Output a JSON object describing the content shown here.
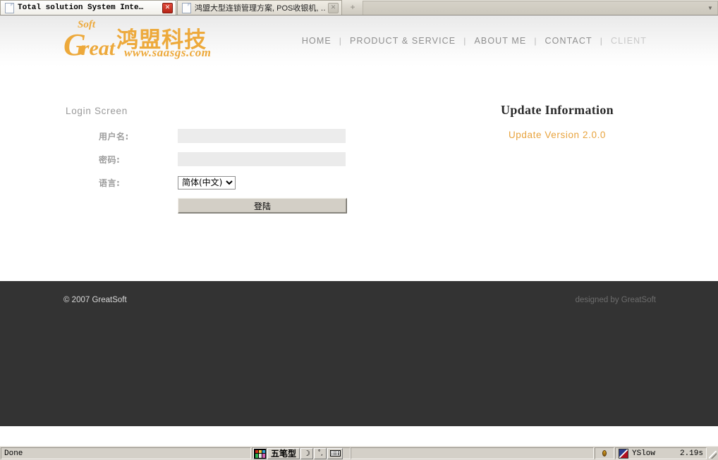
{
  "browser": {
    "tabs": [
      {
        "title": "Total solution System Inte…",
        "active": true,
        "close_icon": "close-icon",
        "page_icon": "page-icon"
      },
      {
        "title": "鸿盟大型连锁管理方案, POS收银机, …",
        "active": false,
        "close_icon": "close-icon",
        "page_icon": "page-icon"
      }
    ],
    "new_tab_label": "+",
    "tab_list_icon": "chevron-down-icon"
  },
  "site": {
    "logo": {
      "soft": "Soft",
      "g": "G",
      "reat": "reat",
      "chinese": "鸿盟科技",
      "url": "www.saasgs.com",
      "color": "#eda93b"
    },
    "nav": {
      "items": [
        {
          "label": "HOME",
          "dim": false
        },
        {
          "label": "PRODUCT & SERVICE",
          "dim": false
        },
        {
          "label": "ABOUT ME",
          "dim": false
        },
        {
          "label": "CONTACT",
          "dim": false
        },
        {
          "label": "CLIENT",
          "dim": true
        }
      ],
      "separator": "|"
    }
  },
  "login": {
    "screen_title": "Login Screen",
    "fields": {
      "username_label": "用户名:",
      "username_value": "",
      "username_placeholder": "",
      "password_label": "密码:",
      "password_value": "",
      "password_placeholder": "",
      "language_label": "语言:",
      "language_selected": "简体(中文)",
      "language_options": [
        "简体(中文)"
      ]
    },
    "submit_label": "登陆"
  },
  "update": {
    "title": "Update Information",
    "version_text": "Update Version 2.0.0",
    "version_color": "#e8a33d"
  },
  "footer": {
    "copyright": "© 2007 GreatSoft",
    "designed_by": "designed by GreatSoft",
    "background": "#333333"
  },
  "statusbar": {
    "status_text": "Done",
    "ime": {
      "logo_icon": "ime-logo-icon",
      "name": "五笔型",
      "moon_icon": "moon-icon",
      "punctuation_icon": "punctuation-icon",
      "keyboard_icon": "keyboard-icon"
    },
    "firebug_icon": "bug-icon",
    "yslow_icon": "yslow-icon",
    "yslow_label": "YSlow",
    "yslow_time": "2.19s",
    "resize_grip": "resize-grip-icon"
  }
}
